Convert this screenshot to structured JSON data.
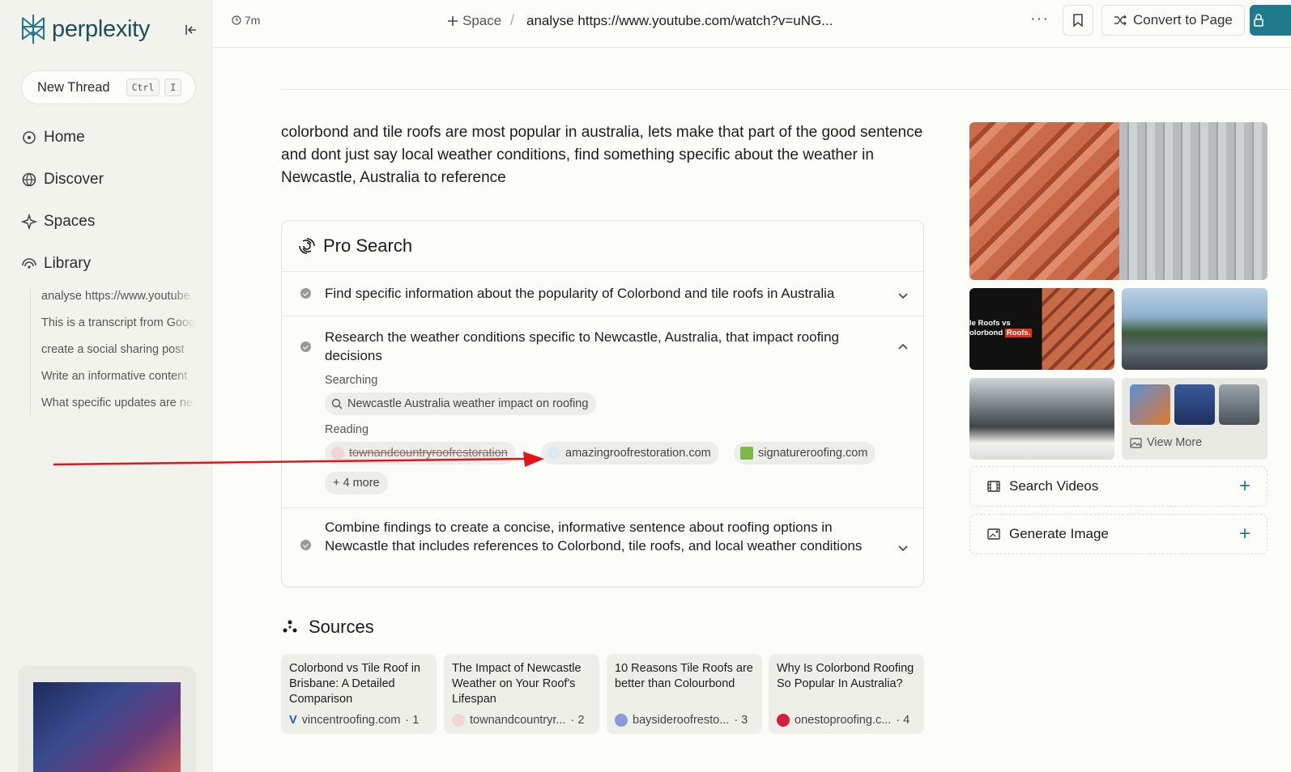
{
  "brand": {
    "name": "perplexity"
  },
  "sidebar": {
    "new_thread": {
      "label": "New Thread",
      "key1": "Ctrl",
      "key2": "I"
    },
    "nav": [
      {
        "label": "Home",
        "icon": "home-icon"
      },
      {
        "label": "Discover",
        "icon": "globe-icon"
      },
      {
        "label": "Spaces",
        "icon": "spaces-icon"
      },
      {
        "label": "Library",
        "icon": "library-icon"
      }
    ],
    "library_items": [
      "analyse https://www.youtube.com",
      "This is a transcript from Google",
      "create a social sharing post",
      "Write an informative content",
      "What specific updates are needed"
    ]
  },
  "topbar": {
    "time": "7m",
    "space": "Space",
    "thread_title": "analyse https://www.youtube.com/watch?v=uNG...",
    "more": "···",
    "convert_label": "Convert to Page"
  },
  "query": "colorbond and tile roofs are most popular in australia, lets make that part of the good sentence and dont just say local weather conditions, find something specific about the weather in Newcastle, Australia to reference",
  "pro_search": {
    "title": "Pro Search",
    "steps": [
      {
        "text": "Find specific information about the popularity of Colorbond and tile roofs in Australia"
      },
      {
        "text": "Research the weather conditions specific to Newcastle, Australia, that impact roofing decisions"
      },
      {
        "text": "Combine findings to create a concise, informative sentence about roofing options in Newcastle that includes references to Colorbond, tile roofs, and local weather conditions"
      }
    ],
    "searching_label": "Searching",
    "search_query": "Newcastle Australia weather impact on roofing",
    "reading_label": "Reading",
    "reading_sites": [
      "townandcountryroofrestoration",
      "amazingroofrestoration.com",
      "signatureroofing.com"
    ],
    "more_label": "+ 4 more"
  },
  "sources": {
    "title": "Sources",
    "items": [
      {
        "title": "Colorbond vs Tile Roof in Brisbane: A Detailed Comparison",
        "site": "vincentroofing.com",
        "index": "· 1"
      },
      {
        "title": "The Impact of Newcastle Weather on Your Roof's Lifespan",
        "site": "townandcountryr...",
        "index": "· 2"
      },
      {
        "title": "10 Reasons Tile Roofs are better than Colourbond",
        "site": "baysideroofresto...",
        "index": "· 3"
      },
      {
        "title": "Why Is Colorbond Roofing So Popular In Australia?",
        "site": "onestoproofing.c...",
        "index": "· 4"
      }
    ]
  },
  "media": {
    "image_caption_line1": "le Roofs vs",
    "image_caption_line2": "olorbond",
    "image_caption_highlight": "Roofs.",
    "view_more": "View More",
    "search_videos": "Search Videos",
    "generate_image": "Generate Image"
  },
  "colors": {
    "accent": "#1f7a8c",
    "annotation_arrow": "#e0161b"
  }
}
